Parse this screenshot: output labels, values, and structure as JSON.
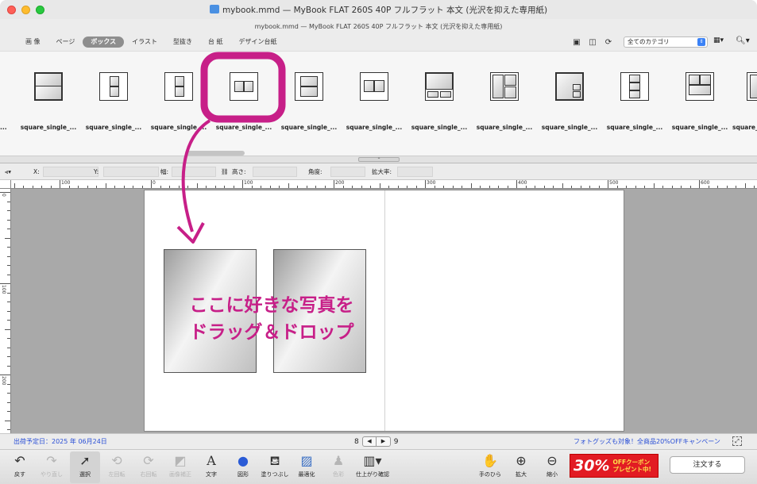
{
  "window": {
    "title": "mybook.mmd — MyBook FLAT 260S 40P フルフラット 本文 (光沢を抑えた専用紙)",
    "subtitle": "mybook.mmd — MyBook FLAT 260S 40P フルフラット 本文 (光沢を抑えた専用紙)"
  },
  "palette": {
    "tabs": [
      {
        "label": "画 像",
        "active": false
      },
      {
        "label": "ページ",
        "active": false
      },
      {
        "label": "ボックス",
        "active": true
      },
      {
        "label": "イラスト",
        "active": false
      },
      {
        "label": "型抜き",
        "active": false
      },
      {
        "label": "台 紙",
        "active": false
      },
      {
        "label": "デザイン台紙",
        "active": false
      }
    ],
    "category": "全てのカテゴリ",
    "templates": [
      {
        "label": "square_single_..."
      },
      {
        "label": "square_single_..."
      },
      {
        "label": "square_single_..."
      },
      {
        "label": "square_single_..."
      },
      {
        "label": "square_single_..."
      },
      {
        "label": "square_single_..."
      },
      {
        "label": "square_single_..."
      },
      {
        "label": "square_single_..."
      },
      {
        "label": "square_single_..."
      },
      {
        "label": "square_single_..."
      },
      {
        "label": "square_single_..."
      },
      {
        "label": "square_single_..."
      }
    ],
    "first_partial_label": "..."
  },
  "measure": {
    "x_label": "X:",
    "y_label": "Y:",
    "w_label": "幅:",
    "h_label": "高さ:",
    "angle_label": "角度:",
    "zoom_label": "拡大率:"
  },
  "ruler": {
    "h_labels": [
      "100",
      "0",
      "100",
      "200",
      "300",
      "400",
      "500",
      "600"
    ],
    "v_labels": [
      "0",
      "100",
      "200"
    ]
  },
  "overlay": {
    "line1": "ここに好きな写真を",
    "line2": "ドラッグ＆ドロップ",
    "accent": "#c71f88"
  },
  "status": {
    "ship_date": "出荷予定日：2025 年 06月24日",
    "page_left": "8",
    "page_right": "9",
    "prev": "◀",
    "next": "▶",
    "promo": "フォトグッズも対象！全商品20%OFFキャンペーン"
  },
  "toolbar": {
    "undo": "戻す",
    "redo": "やり直し",
    "select": "選択",
    "rotate_left": "左回転",
    "rotate_right": "右回転",
    "fit_box": "画像補正",
    "text": "文字",
    "shape": "図形",
    "fill": "塗りつぶし",
    "optimize": "最適化",
    "color": "色彩",
    "preview": "仕上がり確認",
    "hand": "手のひら",
    "zoom_in": "拡大",
    "zoom_out": "縮小",
    "coupon_big": "30%",
    "coupon_small_1": "OFFクーポン",
    "coupon_small_2": "プレゼント中!",
    "order": "注文する"
  }
}
